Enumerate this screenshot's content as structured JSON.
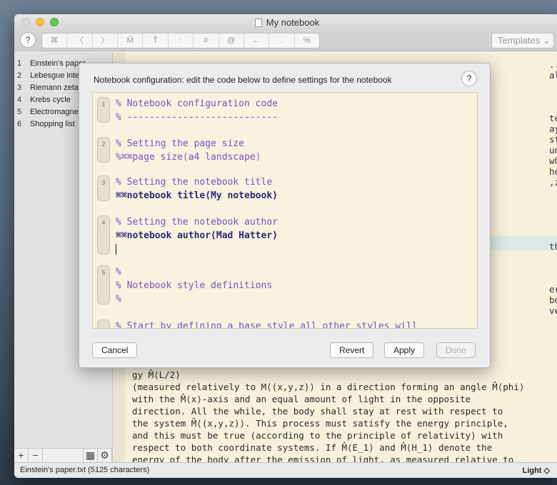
{
  "window": {
    "title": "My notebook"
  },
  "toolbar": {
    "help_label": "?",
    "buttons": [
      "⌘",
      "〈",
      "〉",
      "M̂",
      "T̂",
      ":",
      "#",
      "@",
      "←",
      ".",
      "%"
    ],
    "templates_label": "Templates ⌄"
  },
  "sidebar": {
    "items": [
      {
        "num": "1",
        "label": "Einstein's paper"
      },
      {
        "num": "2",
        "label": "Lebesgue integral"
      },
      {
        "num": "3",
        "label": "Riemann zeta"
      },
      {
        "num": "4",
        "label": "Krebs cycle"
      },
      {
        "num": "5",
        "label": "Electromagnetism"
      },
      {
        "num": "6",
        "label": "Shopping list"
      }
    ],
    "add_label": "+",
    "remove_label": "−",
    "grid_label": "▦",
    "gear_label": "⚙"
  },
  "editor": {
    "right_lines": [
      "       ... ",
      "alic⟨loc.",
      "",
      "",
      "",
      "te system",
      "ay (the",
      "stem. If",
      " uniformly",
      " whose",
      "he above-",
      ",zeta⟩)---",
      "",
      "",
      "",
      "",
      "",
      "this",
      "",
      "",
      "",
      "ergy,",
      " body with",
      " velocity"
    ],
    "paragraph": [
      "                                            gy M̂⟨L/2⟩",
      "(measured relatively to M⟨(x,y,z)⟩ in a direction forming an angle M̂⟨phi⟩",
      "with the M̂⟨x⟩-axis and an equal amount of light in the opposite",
      "direction. All the while, the body shall stay at rest with respect to",
      "the system M̂⟨(x,y,z)⟩. This process must satisfy the energy principle,",
      "and this must be true (according to the principle of relativity) with",
      "respect to both coordinate systems. If M̂⟨E_1⟩ and M̂⟨H_1⟩ denote the",
      "energy of the body after the emission of light, as measured relative to"
    ]
  },
  "status": {
    "left": "Einstein's paper.txt (5125 characters)",
    "right": "Light ◇"
  },
  "dialog": {
    "title": "Notebook configuration: edit the code below to define settings for the notebook",
    "help_label": "?",
    "blocks": [
      {
        "num": "1",
        "lines": [
          {
            "cls": "cm",
            "text": "% Notebook configuration code"
          },
          {
            "cls": "cm",
            "text": "% ---------------------------"
          }
        ]
      },
      {
        "num": "2",
        "lines": [
          {
            "cls": "cm",
            "text": "% Setting the page size"
          },
          {
            "cls": "cm",
            "text": "%⌘⌘page size⟨a4 landscape⟩"
          }
        ]
      },
      {
        "num": "3",
        "lines": [
          {
            "cls": "cm",
            "text": "% Setting the notebook title"
          },
          {
            "cls": "cd",
            "text": "⌘⌘notebook title⟨My notebook⟩"
          }
        ]
      },
      {
        "num": "4",
        "lines": [
          {
            "cls": "cm",
            "text": "% Setting the notebook author"
          },
          {
            "cls": "cd",
            "text": "⌘⌘notebook author⟨Mad Hatter⟩"
          }
        ]
      },
      {
        "num": "5",
        "lines": [
          {
            "cls": "cm",
            "text": "%"
          },
          {
            "cls": "cm",
            "text": "% Notebook style definitions"
          },
          {
            "cls": "cm",
            "text": "%"
          }
        ]
      },
      {
        "num": "",
        "lines": [
          {
            "cls": "cm",
            "text": "% Start by defining a base style all other styles will"
          }
        ]
      }
    ],
    "cancel_label": "Cancel",
    "revert_label": "Revert",
    "apply_label": "Apply",
    "done_label": "Done"
  }
}
